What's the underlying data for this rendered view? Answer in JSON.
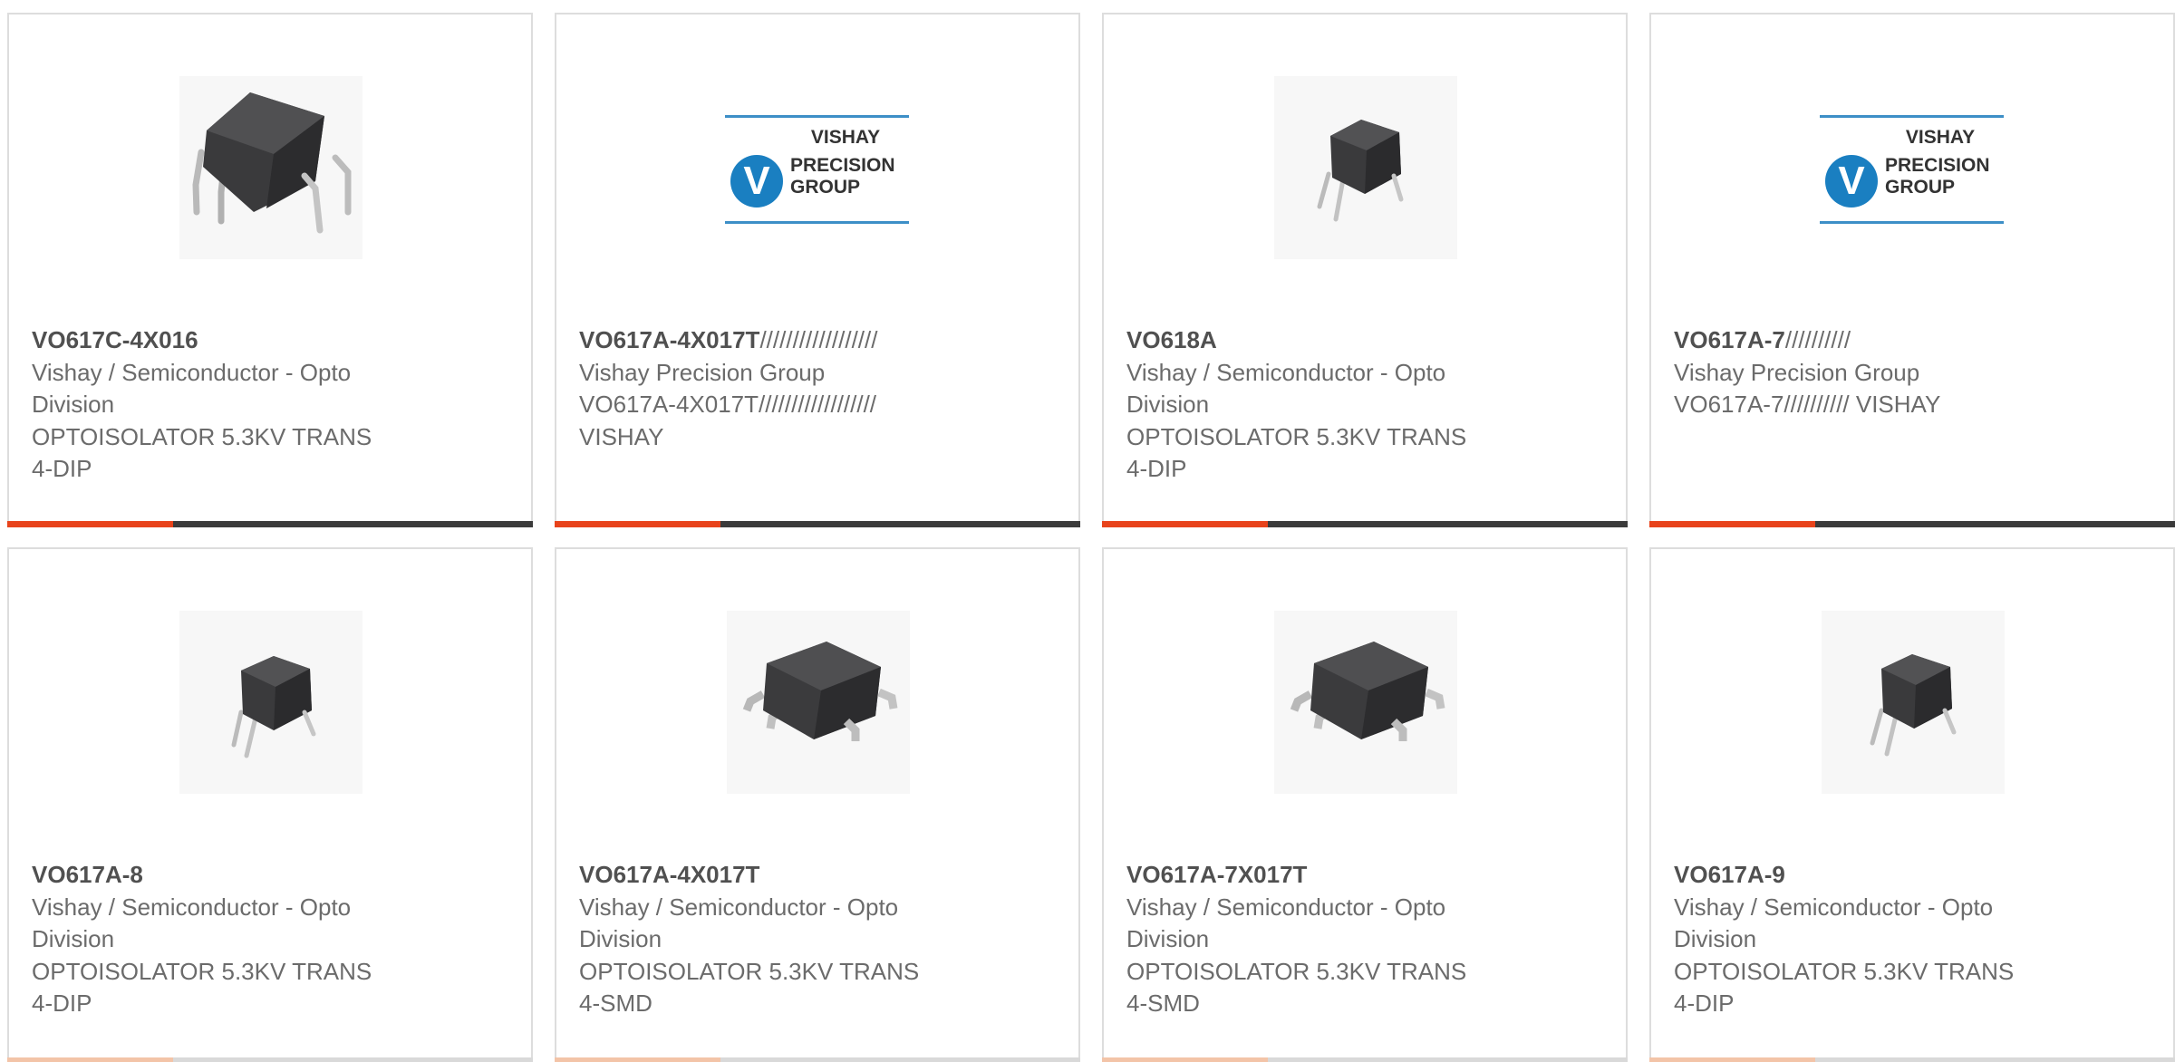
{
  "colors": {
    "accent": "#e8431b",
    "bar": "#3b3b3b",
    "border": "#dddddd",
    "part_number": "#505050",
    "text": "#6b6b6b"
  },
  "products": [
    {
      "part_number": "VO617C-4X016",
      "part_tail": "",
      "manufacturer_lines": [
        "Vishay / Semiconductor - Opto",
        "Division"
      ],
      "description_lines": [
        "OPTOISOLATOR 5.3KV TRANS",
        "4-DIP"
      ],
      "image": "dip4-large-icon"
    },
    {
      "part_number": "VO617A-4X017T",
      "part_tail": "//////////////////",
      "manufacturer_lines": [
        "Vishay Precision Group"
      ],
      "description_lines": [
        "VO617A-4X017T//////////////////",
        "VISHAY"
      ],
      "image": "vishay-precision-group-logo",
      "logo": {
        "line1": "VISHAY",
        "line2": "PRECISION",
        "line3": "GROUP",
        "mark": "V"
      }
    },
    {
      "part_number": "VO618A",
      "part_tail": "",
      "manufacturer_lines": [
        "Vishay / Semiconductor - Opto",
        "Division"
      ],
      "description_lines": [
        "OPTOISOLATOR 5.3KV TRANS",
        "4-DIP"
      ],
      "image": "dip4-small-icon"
    },
    {
      "part_number": "VO617A-7",
      "part_tail": "//////////",
      "manufacturer_lines": [
        "Vishay Precision Group"
      ],
      "description_lines": [
        "VO617A-7////////// VISHAY"
      ],
      "image": "vishay-precision-group-logo",
      "logo": {
        "line1": "VISHAY",
        "line2": "PRECISION",
        "line3": "GROUP",
        "mark": "V"
      }
    },
    {
      "part_number": "VO617A-8",
      "part_tail": "",
      "manufacturer_lines": [
        "Vishay / Semiconductor - Opto",
        "Division"
      ],
      "description_lines": [
        "OPTOISOLATOR 5.3KV TRANS",
        "4-DIP"
      ],
      "image": "dip4-small-icon"
    },
    {
      "part_number": "VO617A-4X017T",
      "part_tail": "",
      "manufacturer_lines": [
        "Vishay / Semiconductor - Opto",
        "Division"
      ],
      "description_lines": [
        "OPTOISOLATOR 5.3KV TRANS",
        "4-SMD"
      ],
      "image": "smd4-icon"
    },
    {
      "part_number": "VO617A-7X017T",
      "part_tail": "",
      "manufacturer_lines": [
        "Vishay / Semiconductor - Opto",
        "Division"
      ],
      "description_lines": [
        "OPTOISOLATOR 5.3KV TRANS",
        "4-SMD"
      ],
      "image": "smd4-icon"
    },
    {
      "part_number": "VO617A-9",
      "part_tail": "",
      "manufacturer_lines": [
        "Vishay / Semiconductor - Opto",
        "Division"
      ],
      "description_lines": [
        "OPTOISOLATOR 5.3KV TRANS",
        "4-DIP"
      ],
      "image": "dip4-small-icon"
    }
  ]
}
